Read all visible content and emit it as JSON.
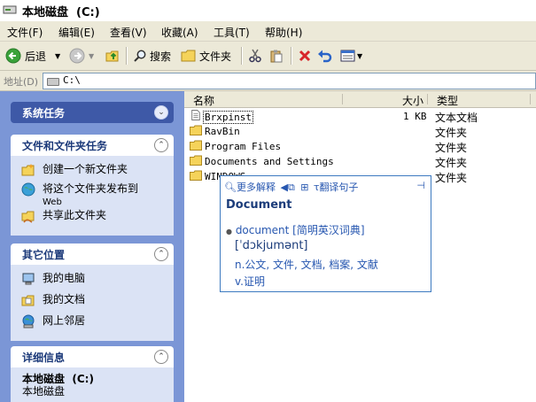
{
  "window": {
    "title": "本地磁盘  (C:)"
  },
  "menu": [
    "文件(F)",
    "编辑(E)",
    "查看(V)",
    "收藏(A)",
    "工具(T)",
    "帮助(H)"
  ],
  "toolbar": {
    "back_label": "后退",
    "search_label": "搜索",
    "folders_label": "文件夹"
  },
  "address": {
    "label": "地址(D)",
    "path": "C:\\"
  },
  "left_pane": {
    "system_tasks": {
      "title": "系统任务"
    },
    "file_tasks": {
      "title": "文件和文件夹任务",
      "items": [
        {
          "label": "创建一个新文件夹",
          "sub": ""
        },
        {
          "label": "将这个文件夹发布到",
          "sub": "Web"
        },
        {
          "label": "共享此文件夹",
          "sub": ""
        }
      ]
    },
    "other_places": {
      "title": "其它位置",
      "items": [
        "我的电脑",
        "我的文档",
        "网上邻居"
      ]
    },
    "details": {
      "title": "详细信息",
      "name": "本地磁盘  (C:)",
      "type": "本地磁盘"
    }
  },
  "columns": {
    "name": "名称",
    "size": "大小",
    "type": "类型"
  },
  "files": [
    {
      "name": "Brxpinst",
      "size": "1 KB",
      "type": "文本文档",
      "icon": "text-file-icon"
    },
    {
      "name": "RavBin",
      "size": "",
      "type": "文件夹",
      "icon": "folder-icon"
    },
    {
      "name": "Program Files",
      "size": "",
      "type": "文件夹",
      "icon": "folder-icon"
    },
    {
      "name": "Documents and Settings",
      "size": "",
      "type": "文件夹",
      "icon": "folder-icon"
    },
    {
      "name": "WINDOWS",
      "size": "",
      "type": "文件夹",
      "icon": "folder-icon"
    }
  ],
  "popup": {
    "more_label": "更多解释",
    "translate_label": "翻译句子",
    "headword": "Document",
    "entry": "document [简明英汉词典]",
    "phonetic": "[ˈdɔkjumənt]",
    "noun": "n.公文, 文件, 文档, 档案, 文献",
    "verb": "v.证明"
  },
  "colors": {
    "pane_bg": "#7b96d6",
    "panel_body": "#dbe3f5",
    "link_blue": "#2757b0",
    "popup_border": "#3d7ac0"
  }
}
